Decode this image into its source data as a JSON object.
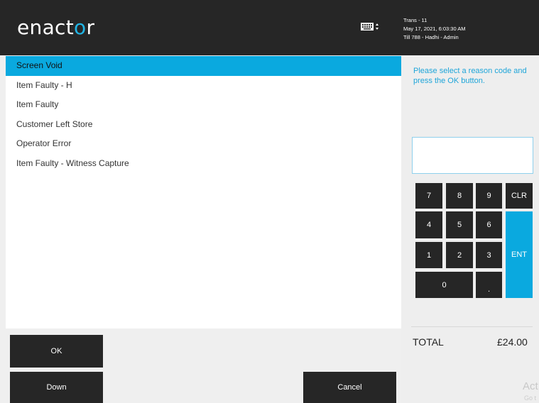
{
  "header": {
    "logo_text_start": "enact",
    "logo_text_o": "o",
    "logo_text_end": "r",
    "keyboard_icon": "keyboard-icon",
    "trans": "Trans - 11",
    "datetime": "May 17, 2021, 6:03:30 AM",
    "till": "Till 788 - Hadhi - Admin"
  },
  "reasons": {
    "items": [
      {
        "label": "Screen Void",
        "selected": true
      },
      {
        "label": "Item Faulty - H",
        "selected": false
      },
      {
        "label": "Item Faulty",
        "selected": false
      },
      {
        "label": "Customer Left Store",
        "selected": false
      },
      {
        "label": "Operator Error",
        "selected": false
      },
      {
        "label": "Item Faulty - Witness Capture",
        "selected": false
      }
    ]
  },
  "prompt": {
    "text": "Please select a reason code and press the OK button."
  },
  "entry": {
    "value": ""
  },
  "keypad": {
    "k7": "7",
    "k8": "8",
    "k9": "9",
    "clr": "CLR",
    "k4": "4",
    "k5": "5",
    "k6": "6",
    "k1": "1",
    "k2": "2",
    "k3": "3",
    "ent": "ENT",
    "k0": "0",
    "dot": "."
  },
  "totals": {
    "label": "TOTAL",
    "value": "£24.00"
  },
  "buttons": {
    "ok": "OK",
    "down": "Down",
    "cancel": "Cancel"
  },
  "watermark": {
    "line1": "Act",
    "line2": "Go t"
  },
  "colors": {
    "accent": "#0aa9df",
    "header_bg": "#262626",
    "button_bg": "#262626"
  }
}
